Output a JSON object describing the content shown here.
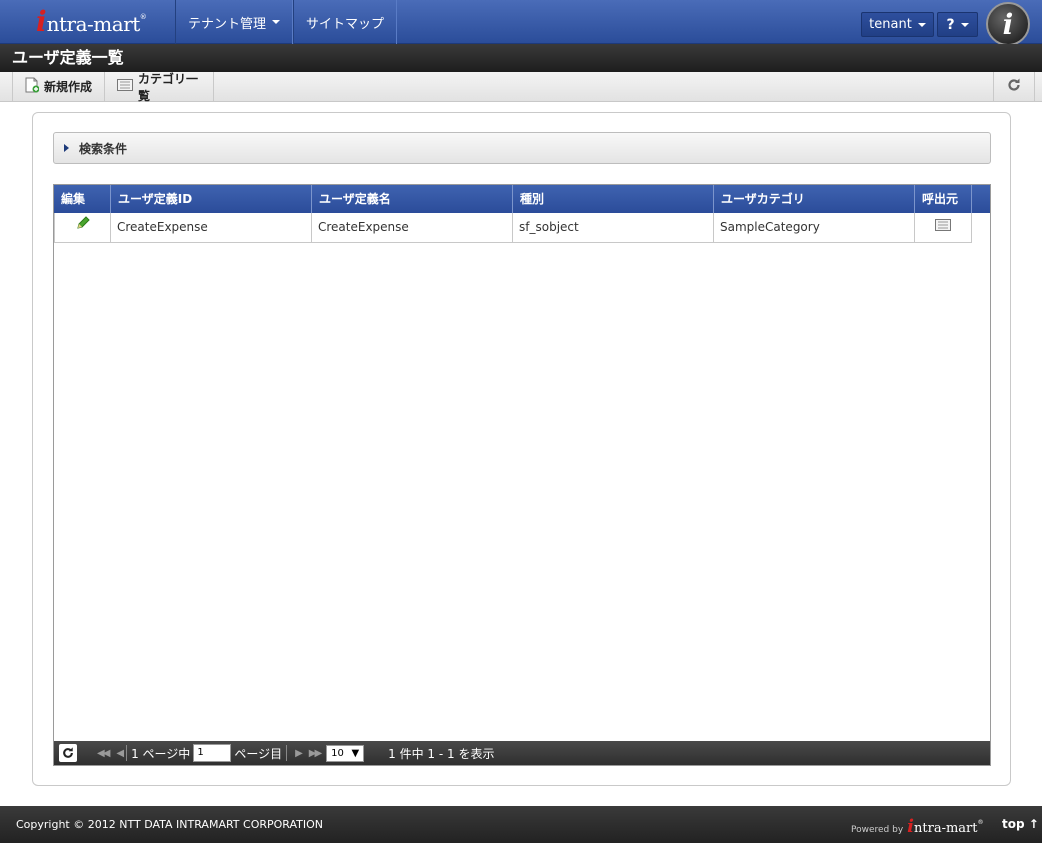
{
  "header": {
    "logo_i": "i",
    "logo_text": "ntra-mart",
    "logo_reg": "®",
    "nav": [
      {
        "label": "テナント管理"
      },
      {
        "label": "サイトマップ"
      }
    ],
    "tenant_label": "tenant",
    "help_label": "?",
    "user_icon_letter": "i",
    "bar_color": "#2b4d9a"
  },
  "page": {
    "title": "ユーザ定義一覧"
  },
  "toolbar": {
    "new_label": "新規作成",
    "category_label": "カテゴリ一覧"
  },
  "search": {
    "label": "検索条件"
  },
  "grid": {
    "columns": [
      "編集",
      "ユーザ定義ID",
      "ユーザ定義名",
      "種別",
      "ユーザカテゴリ",
      "呼出元"
    ],
    "rows": [
      {
        "id": "CreateExpense",
        "name": "CreateExpense",
        "type": "sf_sobject",
        "category": "SampleCategory"
      }
    ]
  },
  "pager": {
    "page_prefix": "1 ページ中",
    "page_value": "1",
    "page_suffix": "ページ目",
    "rows_per_page": "10",
    "count_text": "1 件中 1 - 1 を表示"
  },
  "footer": {
    "copyright": "Copyright © 2012 NTT DATA INTRAMART CORPORATION",
    "powered_by": "Powered by",
    "logo_i": "i",
    "logo_text": "ntra-mart",
    "logo_reg": "®",
    "top_label": "top ↑"
  }
}
